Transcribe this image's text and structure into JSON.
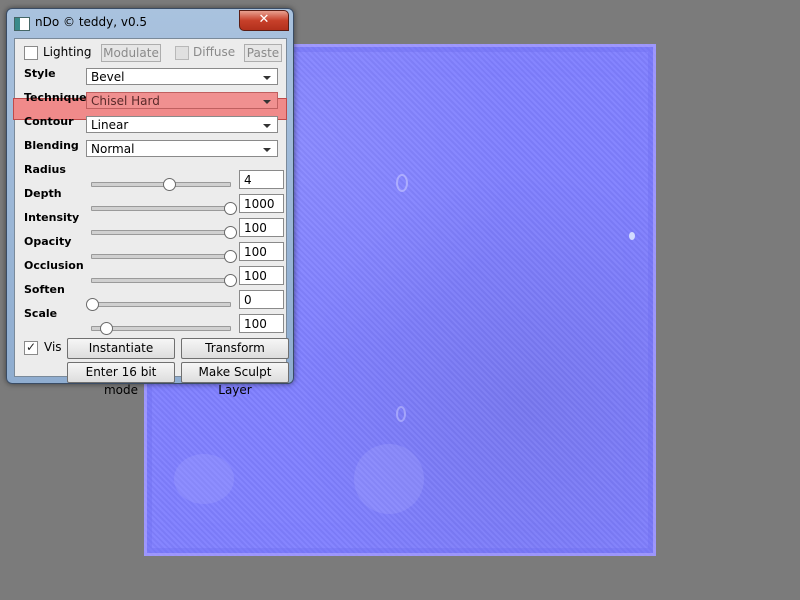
{
  "window": {
    "title": "nDo © teddy, v0.5",
    "close_glyph": "✕"
  },
  "top_row": {
    "lighting": {
      "label": "Lighting",
      "checked": false
    },
    "modulate_label": "Modulate",
    "diffuse": {
      "label": "Diffuse",
      "checked": false
    },
    "paste_label": "Paste"
  },
  "selects": [
    {
      "label": "Style",
      "value": "Bevel"
    },
    {
      "label": "Technique",
      "value": "Chisel Hard"
    },
    {
      "label": "Contour",
      "value": "Linear"
    },
    {
      "label": "Blending",
      "value": "Normal"
    }
  ],
  "sliders": [
    {
      "label": "Radius",
      "value": "4",
      "level": 0.56
    },
    {
      "label": "Depth",
      "value": "1000",
      "level": 1.0
    },
    {
      "label": "Intensity",
      "value": "100",
      "level": 1.0
    },
    {
      "label": "Opacity",
      "value": "100",
      "level": 1.0
    },
    {
      "label": "Occlusion",
      "value": "100",
      "level": 1.0
    },
    {
      "label": "Soften",
      "value": "0",
      "level": 0.0
    },
    {
      "label": "Scale",
      "value": "100",
      "level": 0.1
    }
  ],
  "bottom": {
    "vis": {
      "label": "Vis",
      "checked": true,
      "glyph": "✓"
    },
    "instantiate_label": "Instantiate",
    "transform_label": "Transform",
    "enter16_label": "Enter 16 bit mode",
    "sculpt_label": "Make Sculpt Layer"
  },
  "colors": {
    "normal_map": "#7f7fff",
    "highlight": "#f08a8a",
    "background": "#7b7b7b"
  }
}
